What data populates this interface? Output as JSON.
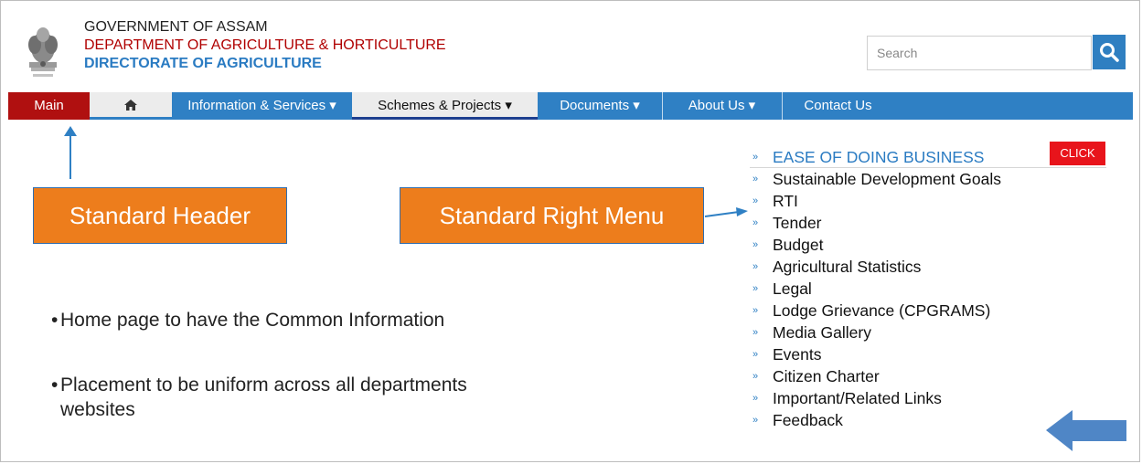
{
  "header": {
    "line1": "GOVERNMENT OF ASSAM",
    "line2": "DEPARTMENT OF AGRICULTURE & HORTICULTURE",
    "line3": "DIRECTORATE OF AGRICULTURE"
  },
  "search": {
    "placeholder": "Search"
  },
  "nav": {
    "main": "Main",
    "info": "Information & Services ▾",
    "schemes": "Schemes & Projects ▾",
    "docs": "Documents ▾",
    "about": "About Us ▾",
    "contact": "Contact Us"
  },
  "callouts": {
    "header": "Standard Header",
    "menu": "Standard Right Menu"
  },
  "bullets": {
    "b1": "Home page to have the Common Information",
    "b2a": "Placement to be uniform across all departments",
    "b2b": "websites"
  },
  "right_menu": {
    "items": [
      "EASE OF DOING BUSINESS",
      "Sustainable Development Goals",
      "RTI",
      "Tender",
      "Budget",
      "Agricultural Statistics",
      "Legal",
      "Lodge Grievance (CPGRAMS)",
      "Media Gallery",
      "Events",
      "Citizen Charter",
      "Important/Related Links",
      "Feedback"
    ],
    "click_label": "CLICK"
  },
  "colors": {
    "nav_blue": "#2f80c4",
    "main_red": "#b01010",
    "callout_orange": "#ed7d1c",
    "click_red": "#e8141b"
  },
  "icons": [
    "emblem-icon",
    "search-icon",
    "home-icon",
    "up-arrow-icon",
    "right-arrow-icon",
    "left-block-arrow-icon"
  ]
}
